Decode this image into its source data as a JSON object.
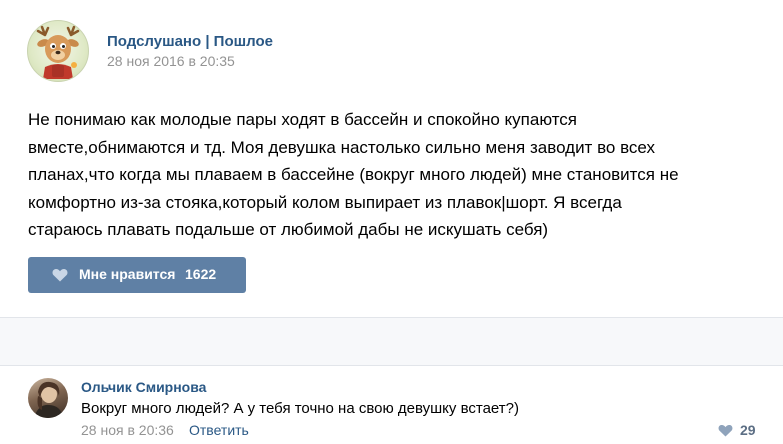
{
  "post": {
    "group_name": "Подслушано | Пошлое",
    "date": "28 ноя 2016 в 20:35",
    "text_lines": [
      "Не понимаю как молодые пары ходят в бассейн и спокойно купаются",
      "вместе,обнимаются и тд. Моя девушка настолько сильно меня заводит во всех",
      "планах,что когда мы плаваем в бассейне (вокруг много людей) мне становится не",
      "комфортно из-за стояка,который колом выпирает из плавок|шорт. Я всегда",
      "стараюсь плавать подальше от любимой дабы не искушать себя)"
    ],
    "like_label": "Мне нравится",
    "like_count": "1622"
  },
  "comment": {
    "author": "Ольчик Смирнова",
    "text": "Вокруг много людей? А у тебя точно на свою девушку встает?)",
    "date": "28 ноя в 20:36",
    "reply_label": "Ответить",
    "like_count": "29"
  },
  "colors": {
    "link": "#2a5885",
    "like_button": "#5f80a5",
    "muted": "#939393"
  },
  "icons": {
    "group_avatar": "deer-avatar",
    "like": "heart-icon"
  }
}
